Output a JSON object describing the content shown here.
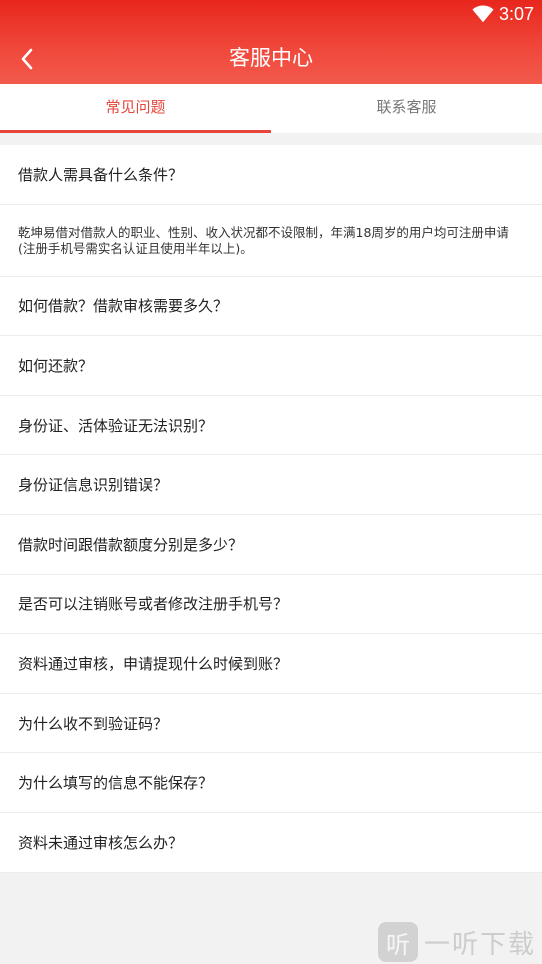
{
  "status_bar": {
    "time": "3:07",
    "wifi_icon": "wifi-icon"
  },
  "header": {
    "title": "客服中心",
    "back_icon": "chevron-left-icon"
  },
  "tabs": [
    {
      "label": "常见问题",
      "active": true
    },
    {
      "label": "联系客服",
      "active": false
    }
  ],
  "faq": {
    "items": [
      {
        "question": "借款人需具备什么条件？",
        "answer": "乾坤易借对借款人的职业、性别、收入状况都不设限制，年满18周岁的用户均可注册申请(注册手机号需实名认证且使用半年以上)。"
      },
      {
        "question": "如何借款？借款审核需要多久？"
      },
      {
        "question": "如何还款？"
      },
      {
        "question": "身份证、活体验证无法识别？"
      },
      {
        "question": "身份证信息识别错误？"
      },
      {
        "question": "借款时间跟借款额度分别是多少？"
      },
      {
        "question": "是否可以注销账号或者修改注册手机号？"
      },
      {
        "question": "资料通过审核，申请提现什么时候到账？"
      },
      {
        "question": "为什么收不到验证码？"
      },
      {
        "question": "为什么填写的信息不能保存？"
      },
      {
        "question": "资料未通过审核怎么办？"
      }
    ]
  },
  "watermark": {
    "logo_char": "听",
    "text": "一听下载"
  },
  "colors": {
    "header": "#f0463a",
    "accent": "#e8463a"
  }
}
